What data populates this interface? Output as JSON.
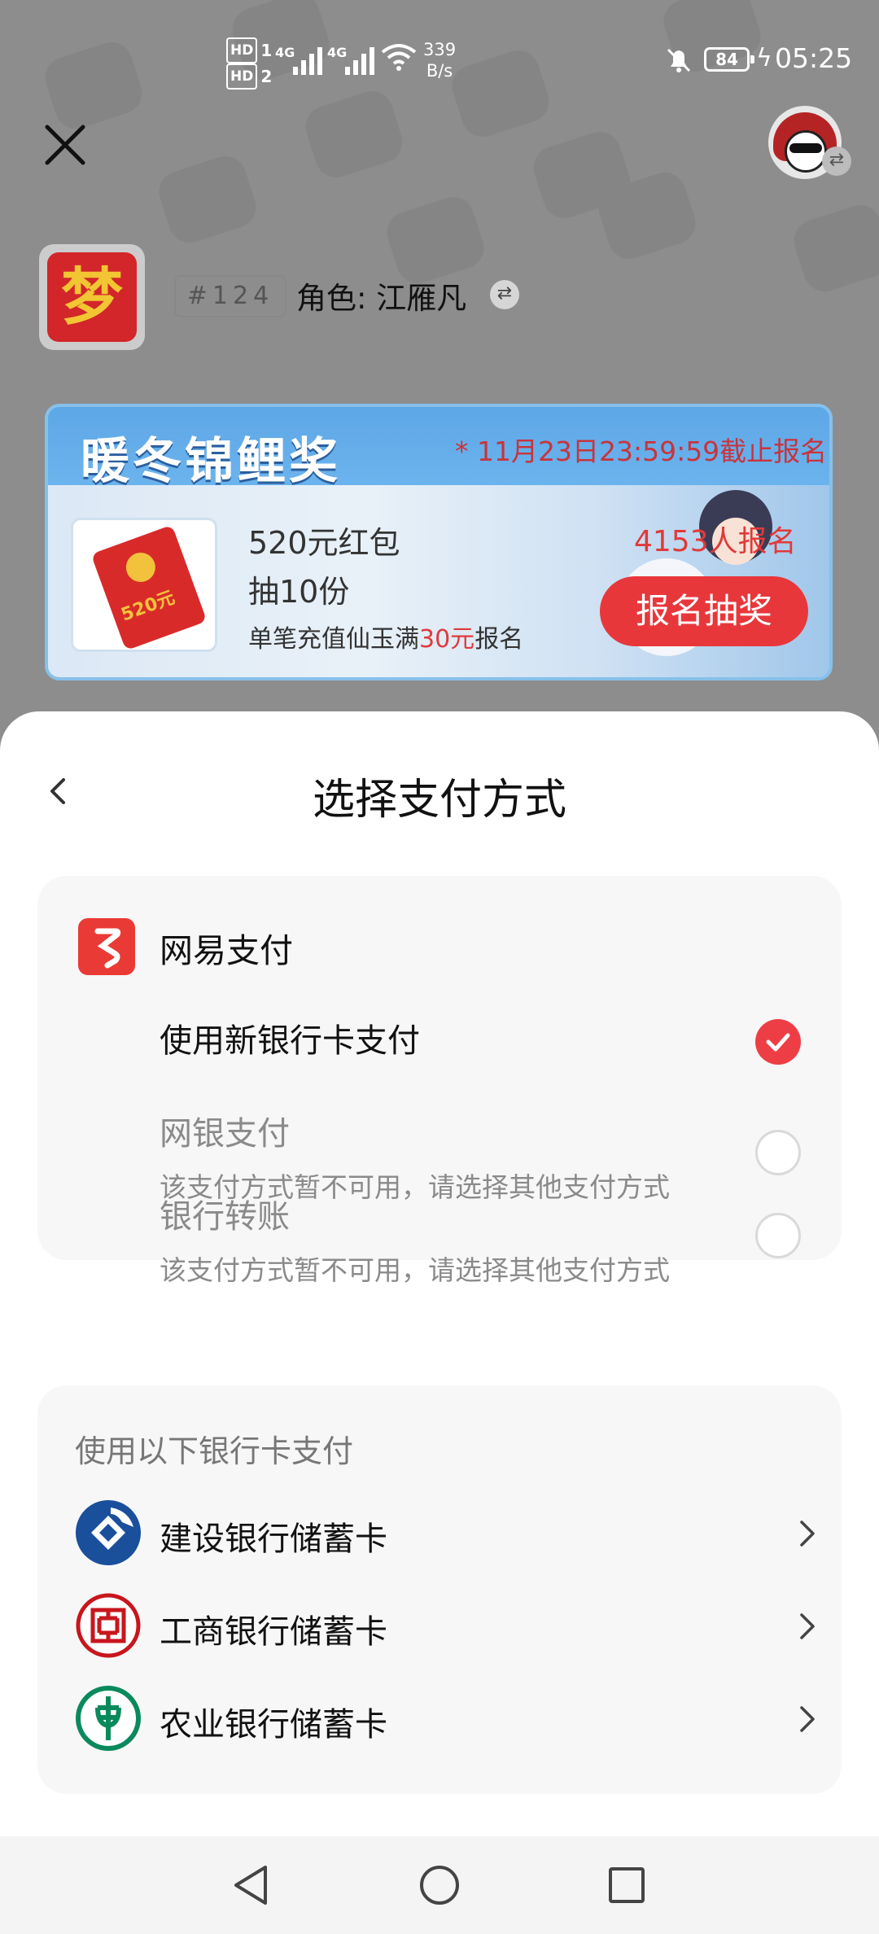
{
  "status_bar": {
    "hd1": "HD",
    "hd1_sub": "1",
    "hd2": "HD",
    "hd2_sub": "2",
    "net1": "4G",
    "net2": "4G",
    "speed_value": "339",
    "speed_unit": "B/s",
    "battery": "84",
    "time": "05:25"
  },
  "header": {
    "close_icon": "close-icon",
    "avatar": "user-avatar",
    "server_tag": "#124",
    "role_label": "角色: 江雁凡",
    "game_logo_char": "梦"
  },
  "banner": {
    "title": "暖冬锦鲤奖",
    "deadline": "* 11月23日23:59:59截止报名",
    "prize_name": "520元红包",
    "prize_count": "抽10份",
    "condition_prefix": "单笔充值仙玉满",
    "condition_amount": "30元",
    "condition_suffix": "报名",
    "signups": "4153人报名",
    "lottery_button": "报名抽奖",
    "envelope_amount": "520元"
  },
  "sheet": {
    "title": "选择支付方式",
    "provider": "网易支付",
    "options": [
      {
        "label": "使用新银行卡支付",
        "note": "",
        "selected": true,
        "enabled": true
      },
      {
        "label": "网银支付",
        "note": "该支付方式暂不可用，请选择其他支付方式",
        "selected": false,
        "enabled": false
      },
      {
        "label": "银行转账",
        "note": "该支付方式暂不可用，请选择其他支付方式",
        "selected": false,
        "enabled": false
      }
    ],
    "bank_section_title": "使用以下银行卡支付",
    "banks": [
      {
        "name": "建设银行储蓄卡",
        "color": "#1a4f9c"
      },
      {
        "name": "工商银行储蓄卡",
        "color": "#c8161d"
      },
      {
        "name": "农业银行储蓄卡",
        "color": "#0a8a5c"
      }
    ]
  },
  "colors": {
    "accent_red": "#ee3e45",
    "netease_red": "#ea3a36"
  }
}
